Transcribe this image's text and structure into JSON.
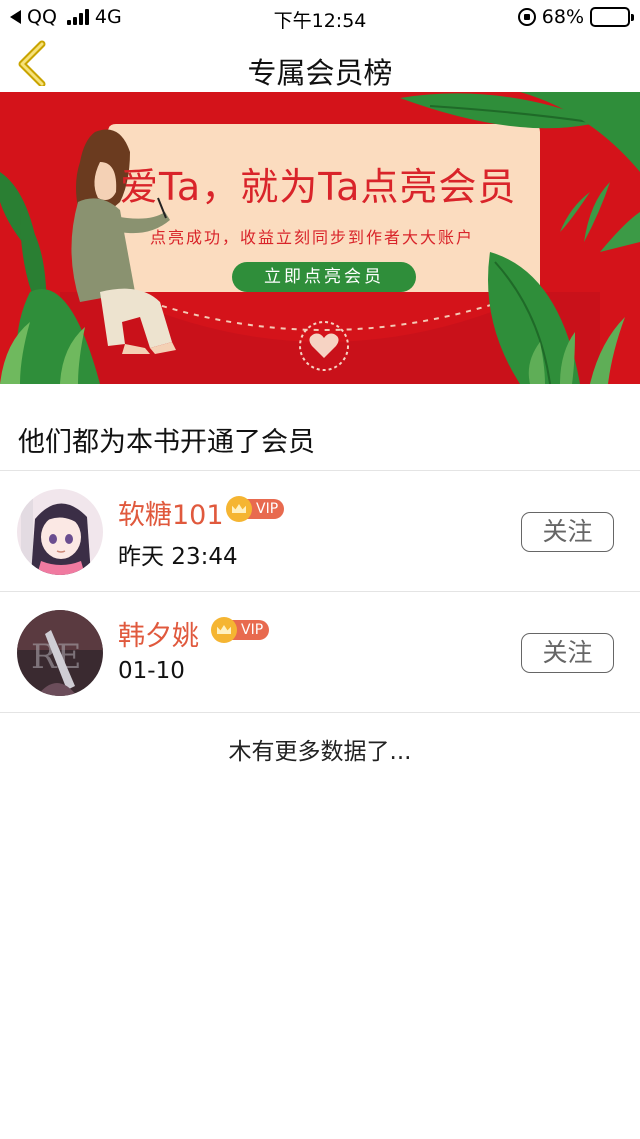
{
  "status_bar": {
    "carrier": "QQ",
    "network": "4G",
    "time": "下午12:54",
    "battery": "68%",
    "battery_level": 0.68
  },
  "nav": {
    "title": "专属会员榜",
    "back_icon": "chevron-left-icon"
  },
  "banner": {
    "title": "爱Ta，就为Ta点亮会员",
    "subtitle": "点亮成功，收益立刻同步到作者大大账户",
    "button": "立即点亮会员",
    "colors": {
      "background": "#d4131a",
      "card": "#fbdcbf",
      "accent_green": "#2f8e3a"
    }
  },
  "section": {
    "title": "他们都为本书开通了会员"
  },
  "members": [
    {
      "name": "软糖101",
      "badge": "VIP",
      "time": "昨天 23:44",
      "follow_label": "关注",
      "avatar": "anime-girl-avatar"
    },
    {
      "name": "韩夕姚",
      "badge": "VIP",
      "time": "01-10",
      "follow_label": "关注",
      "avatar": "photo-avatar"
    }
  ],
  "footer": {
    "no_more": "木有更多数据了..."
  }
}
